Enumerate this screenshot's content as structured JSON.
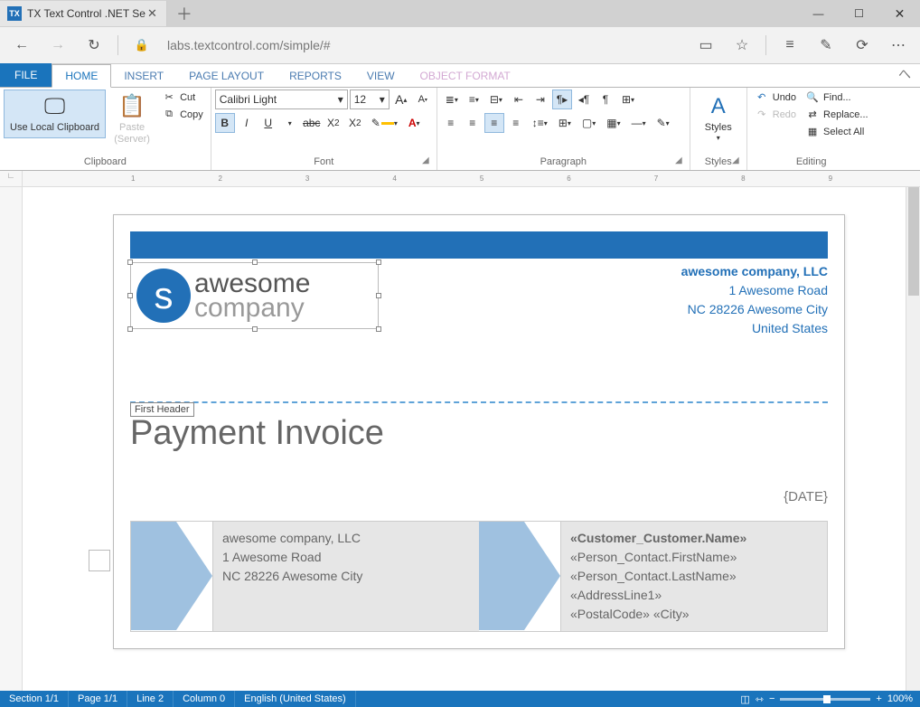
{
  "browser": {
    "tab_title": "TX Text Control .NET Se",
    "favicon": "TX",
    "url_host": "labs.textcontrol.com",
    "url_path": "/simple/#"
  },
  "ribbon": {
    "file": "FILE",
    "tabs": [
      "HOME",
      "INSERT",
      "PAGE LAYOUT",
      "REPORTS",
      "VIEW",
      "OBJECT FORMAT"
    ],
    "active_tab": 0,
    "groups": {
      "clipboard": {
        "label": "Clipboard",
        "local": "Use Local Clipboard",
        "paste": "Paste",
        "paste_sub": "(Server)",
        "cut": "Cut",
        "copy": "Copy"
      },
      "font": {
        "label": "Font",
        "family": "Calibri Light",
        "size": "12"
      },
      "paragraph": {
        "label": "Paragraph"
      },
      "styles": {
        "label": "Styles",
        "btn": "Styles"
      },
      "editing": {
        "label": "Editing",
        "undo": "Undo",
        "redo": "Redo",
        "find": "Find...",
        "replace": "Replace...",
        "select_all": "Select All"
      }
    }
  },
  "ruler_marks": [
    "1",
    "2",
    "3",
    "4",
    "5",
    "6",
    "7",
    "8",
    "9"
  ],
  "doc": {
    "company_name": "awesome company, LLC",
    "addr1": "1 Awesome Road",
    "addr2": "NC 28226 Awesome City",
    "addr3": "United States",
    "logo_top": "awesome",
    "logo_bottom": "company",
    "header_badge": "First Header",
    "title": "Payment Invoice",
    "date": "{DATE}",
    "sender": {
      "l1": "awesome company, LLC",
      "l2": "1 Awesome Road",
      "l3": "NC 28226 Awesome City"
    },
    "recipient": {
      "l1": "«Customer_Customer.Name»",
      "l2": "«Person_Contact.FirstName»",
      "l3": "«Person_Contact.LastName»",
      "l4": "«AddressLine1»",
      "l5": "«PostalCode» «City»"
    }
  },
  "status": {
    "section": "Section 1/1",
    "page": "Page 1/1",
    "line": "Line 2",
    "column": "Column 0",
    "lang": "English (United States)",
    "zoom": "100%"
  }
}
